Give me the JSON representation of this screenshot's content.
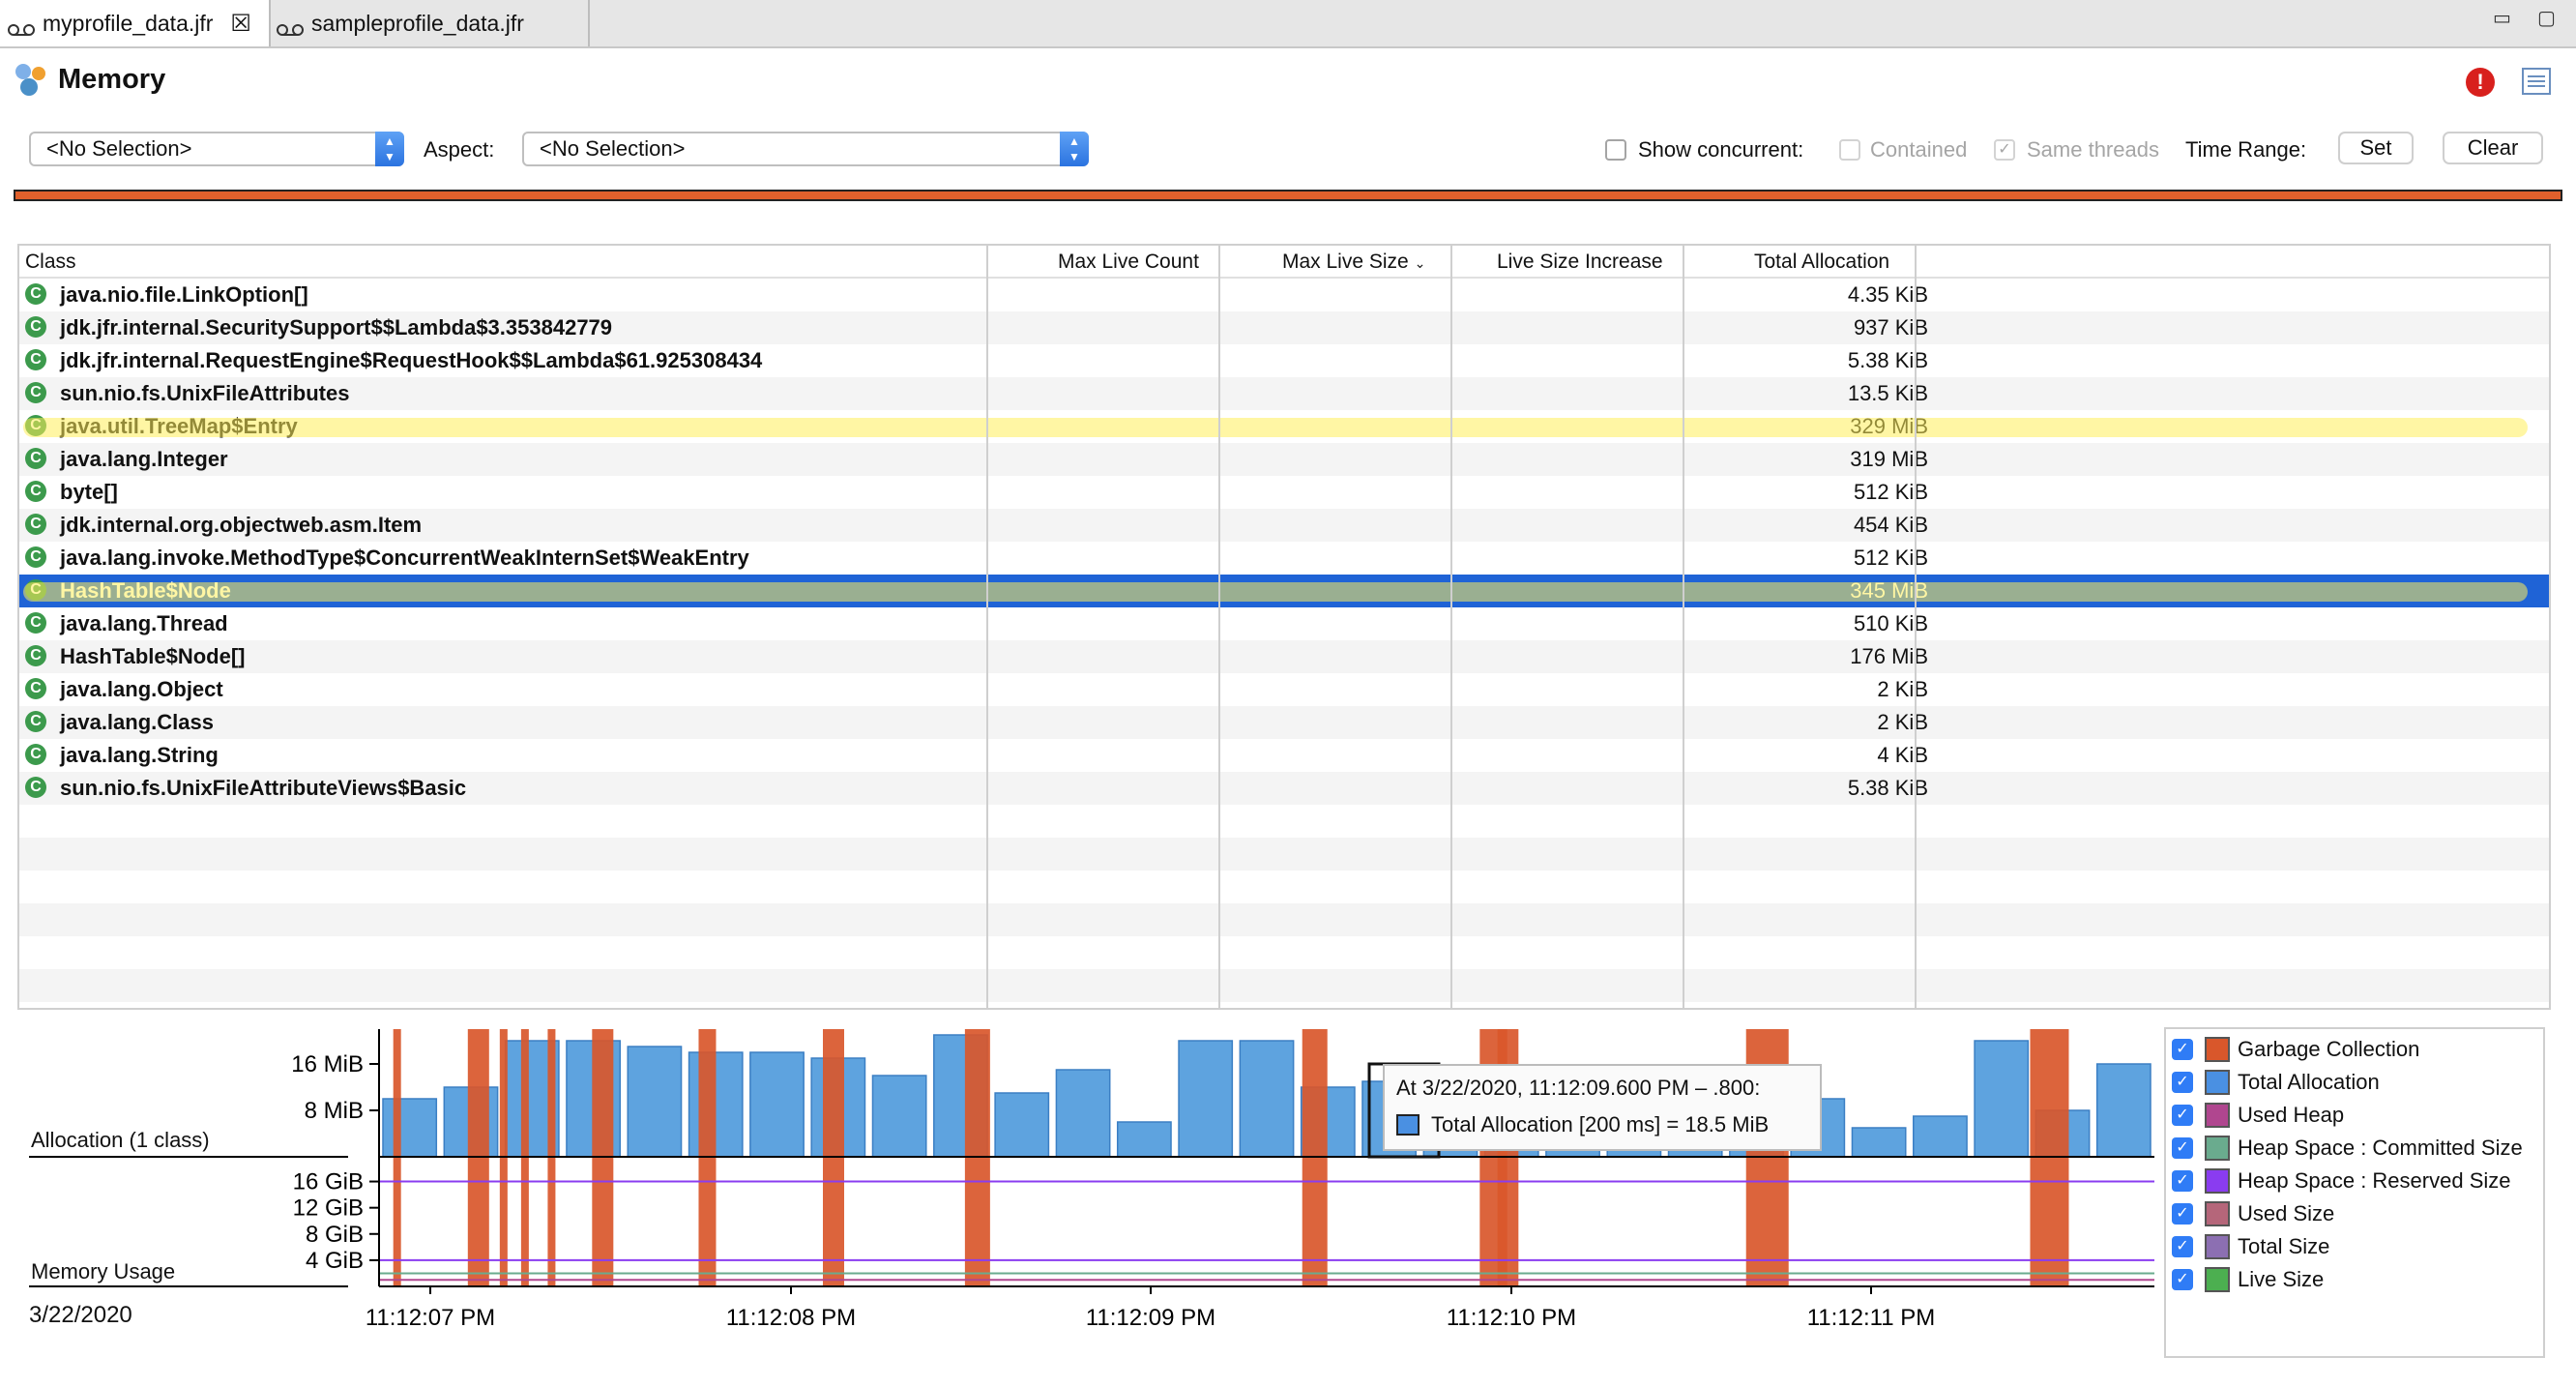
{
  "tabs": [
    {
      "label": "myprofile_data.jfr",
      "active": true
    },
    {
      "label": "sampleprofile_data.jfr",
      "active": false
    }
  ],
  "page": {
    "title": "Memory"
  },
  "filters": {
    "class_select": "<No Selection>",
    "aspect_label": "Aspect:",
    "aspect_select": "<No Selection>",
    "show_concurrent_label": "Show concurrent:",
    "contained_label": "Contained",
    "same_threads_label": "Same threads",
    "same_threads_checked": true,
    "time_range_label": "Time Range:",
    "set_label": "Set",
    "clear_label": "Clear"
  },
  "table": {
    "columns": [
      "Class",
      "Max Live Count",
      "Max Live Size",
      "Live Size Increase",
      "Total Allocation"
    ],
    "sort_column": "Max Live Size",
    "selected_row": 9,
    "rows": [
      {
        "class": "java.nio.file.LinkOption[]",
        "total": "4.35 KiB"
      },
      {
        "class": "jdk.jfr.internal.SecuritySupport$$Lambda$3.353842779",
        "total": "937 KiB"
      },
      {
        "class": "jdk.jfr.internal.RequestEngine$RequestHook$$Lambda$61.925308434",
        "total": "5.38 KiB"
      },
      {
        "class": "sun.nio.fs.UnixFileAttributes",
        "total": "13.5 KiB"
      },
      {
        "class": "java.util.TreeMap$Entry",
        "total": "329 MiB",
        "highlighted": true
      },
      {
        "class": "java.lang.Integer",
        "total": "319 MiB"
      },
      {
        "class": "byte[]",
        "total": "512 KiB"
      },
      {
        "class": "jdk.internal.org.objectweb.asm.Item",
        "total": "454 KiB"
      },
      {
        "class": "java.lang.invoke.MethodType$ConcurrentWeakInternSet$WeakEntry",
        "total": "512 KiB"
      },
      {
        "class": "HashTable$Node",
        "total": "345 MiB",
        "highlighted": true
      },
      {
        "class": "java.lang.Thread",
        "total": "510 KiB"
      },
      {
        "class": "HashTable$Node[]",
        "total": "176 MiB"
      },
      {
        "class": "java.lang.Object",
        "total": "2 KiB"
      },
      {
        "class": "java.lang.Class",
        "total": "2 KiB"
      },
      {
        "class": "java.lang.String",
        "total": "4 KiB"
      },
      {
        "class": "sun.nio.fs.UnixFileAttributeViews$Basic",
        "total": "5.38 KiB"
      }
    ]
  },
  "chart": {
    "allocation_label": "Allocation (1 class)",
    "memory_label": "Memory Usage",
    "date_label": "3/22/2020",
    "alloc_ticks": [
      "16 MiB",
      "8 MiB"
    ],
    "mem_ticks": [
      "16 GiB",
      "12 GiB",
      "8 GiB",
      "4 GiB"
    ],
    "time_ticks": [
      "11:12:07 PM",
      "11:12:08 PM",
      "11:12:09 PM",
      "11:12:10 PM",
      "11:12:11 PM"
    ]
  },
  "chart_data": {
    "type": "bar",
    "title": "",
    "ylabel": "Allocation (1 class)",
    "unit": "MiB",
    "series": [
      {
        "name": "Total Allocation",
        "values": [
          10,
          12,
          20,
          20,
          19,
          18,
          18,
          17,
          14,
          21,
          11,
          15,
          6,
          20,
          20,
          12,
          13,
          10,
          10,
          10,
          10,
          10,
          10,
          10,
          5,
          7,
          20,
          8,
          16
        ]
      }
    ],
    "ylim": [
      0,
      22
    ],
    "gc_markers_count": 14,
    "memory_ylim": [
      0,
      18
    ],
    "memory_ticks_gib": [
      16,
      12,
      8,
      4
    ]
  },
  "tooltip": {
    "line1": "At 3/22/2020, 11:12:09.600 PM – .800:",
    "line2": "Total Allocation [200 ms] = 18.5 MiB"
  },
  "legend": [
    {
      "label": "Garbage Collection",
      "color": "#d9572b"
    },
    {
      "label": "Total Allocation",
      "color": "#4a90e2"
    },
    {
      "label": "Used Heap",
      "color": "#b0468f"
    },
    {
      "label": "Heap Space : Committed Size",
      "color": "#6aab8e"
    },
    {
      "label": "Heap Space : Reserved Size",
      "color": "#8a3cf0"
    },
    {
      "label": "Used Size",
      "color": "#b5667a"
    },
    {
      "label": "Total Size",
      "color": "#8c6fb2"
    },
    {
      "label": "Live Size",
      "color": "#4caf50"
    }
  ]
}
